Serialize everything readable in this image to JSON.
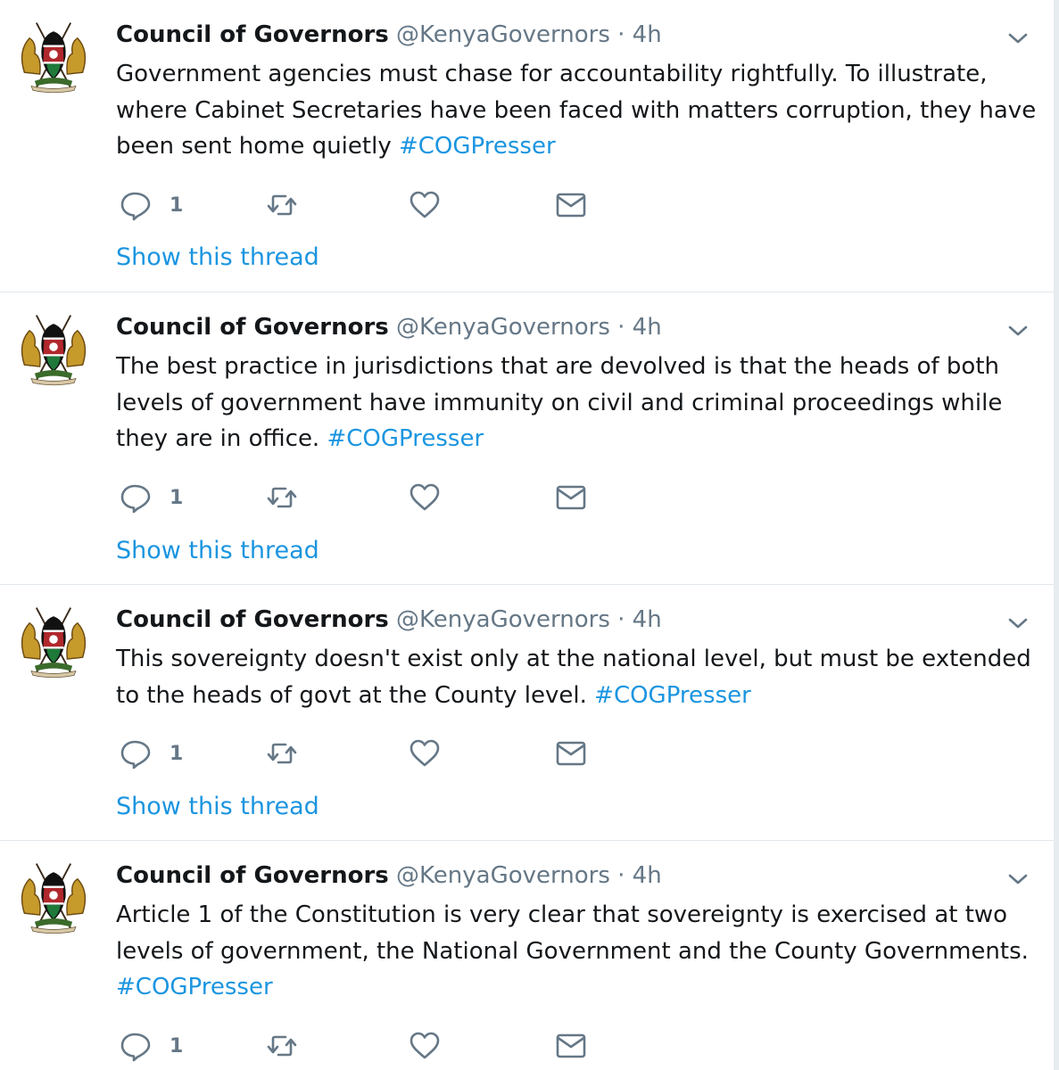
{
  "colors": {
    "link": "#1b95e0",
    "secondary": "#657786",
    "text": "#14171a",
    "divider": "#e1e8ed"
  },
  "tweets": [
    {
      "name": "Council of Governors",
      "handle": "@KenyaGovernors",
      "separator": "·",
      "time": "4h",
      "text": "Government agencies must chase for accountability rightfully. To illustrate, where Cabinet Secretaries have been faced with matters corruption, they have been sent home quietly ",
      "hashtag": "#COGPresser",
      "reply_count": "1",
      "thread_label": "Show this thread"
    },
    {
      "name": "Council of Governors",
      "handle": "@KenyaGovernors",
      "separator": "·",
      "time": "4h",
      "text": "The best practice in jurisdictions that are devolved is that the heads of both levels of government have immunity on civil and criminal proceedings while they are in office. ",
      "hashtag": "#COGPresser",
      "reply_count": "1",
      "thread_label": "Show this thread"
    },
    {
      "name": "Council of Governors",
      "handle": "@KenyaGovernors",
      "separator": "·",
      "time": "4h",
      "text": "This sovereignty doesn't exist only at the national level, but must be extended to the heads of govt at the County level. ",
      "hashtag": "#COGPresser",
      "reply_count": "1",
      "thread_label": "Show this thread"
    },
    {
      "name": "Council of Governors",
      "handle": "@KenyaGovernors",
      "separator": "·",
      "time": "4h",
      "text": "Article 1 of the Constitution is very clear that sovereignty is exercised at two levels of government, the National Government and the County Governments. ",
      "hashtag": "#COGPresser",
      "reply_count": "1",
      "thread_label": ""
    }
  ],
  "icons": {
    "avatar": "kenya-coat-of-arms-icon",
    "menu": "chevron-down-icon",
    "reply": "reply-bubble-icon",
    "retweet": "retweet-icon",
    "like": "heart-icon",
    "message": "envelope-icon"
  }
}
